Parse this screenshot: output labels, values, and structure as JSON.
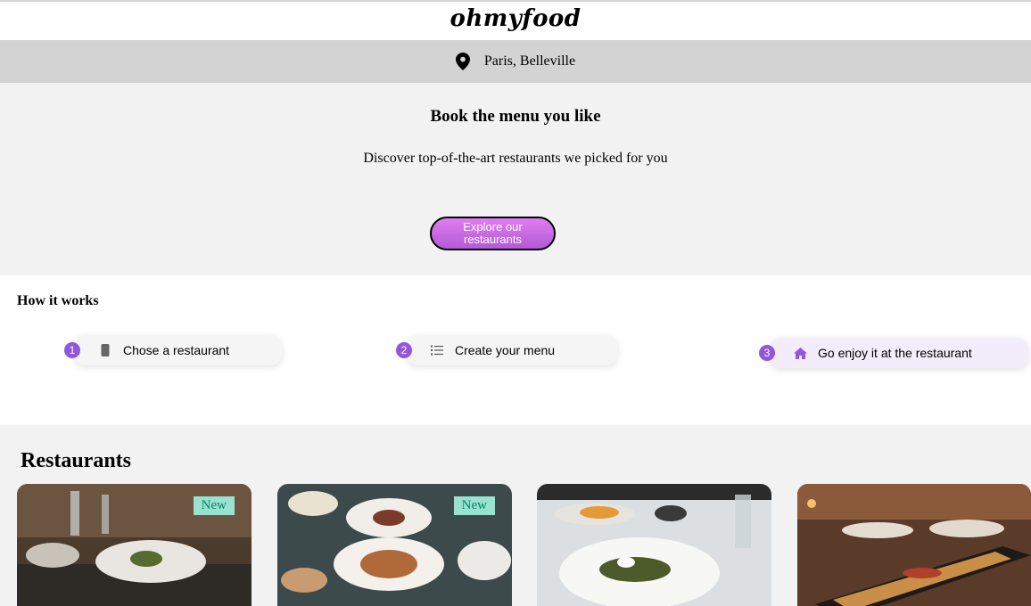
{
  "brand": {
    "logo": "ohmyfood"
  },
  "location": {
    "text": "Paris, Belleville",
    "icon": "location-pin-icon"
  },
  "hero": {
    "title": "Book the menu you like",
    "subtitle": "Discover top-of-the-art restaurants we picked for you",
    "cta_label": "Explore our restaurants"
  },
  "how_it_works": {
    "title": "How it works",
    "steps": [
      {
        "number": "1",
        "label": "Chose a restaurant",
        "icon": "phone-icon"
      },
      {
        "number": "2",
        "label": "Create your menu",
        "icon": "list-icon"
      },
      {
        "number": "3",
        "label": "Go enjoy it at the restaurant",
        "icon": "home-icon"
      }
    ]
  },
  "restaurants": {
    "title": "Restaurants",
    "items": [
      {
        "badge": "New"
      },
      {
        "badge": "New"
      },
      {
        "badge": ""
      },
      {
        "badge": ""
      }
    ]
  },
  "colors": {
    "accent": "#9356dc",
    "cta_start": "#e07df0",
    "cta_end": "#b25ad6",
    "badge_bg": "#99e2d0",
    "badge_text": "#008766"
  }
}
